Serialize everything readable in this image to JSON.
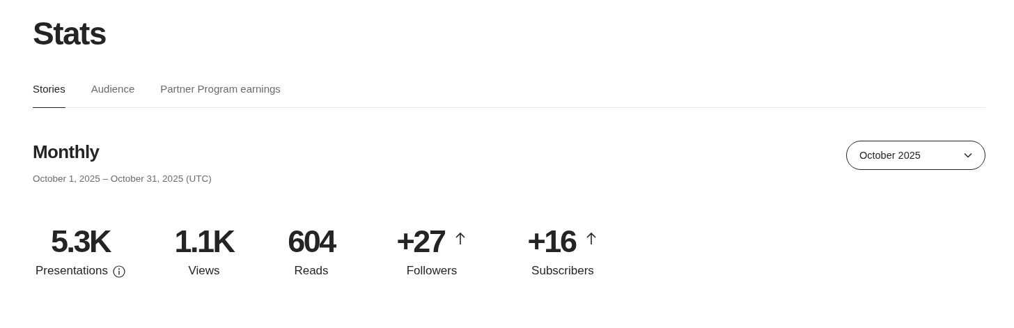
{
  "title": "Stats",
  "tabs": [
    {
      "label": "Stories",
      "selected": true
    },
    {
      "label": "Audience",
      "selected": false
    },
    {
      "label": "Partner Program earnings",
      "selected": false
    }
  ],
  "section": {
    "heading": "Monthly",
    "date_range": "October 1, 2025 – October 31, 2025 (UTC)",
    "period_dropdown": "October 2025"
  },
  "stats": [
    {
      "value": "5.3K",
      "label": "Presentations",
      "info": true,
      "rising": false
    },
    {
      "value": "1.1K",
      "label": "Views",
      "info": false,
      "rising": false
    },
    {
      "value": "604",
      "label": "Reads",
      "info": false,
      "rising": false
    },
    {
      "value": "+27",
      "label": "Followers",
      "info": false,
      "rising": true
    },
    {
      "value": "+16",
      "label": "Subscribers",
      "info": false,
      "rising": true
    }
  ]
}
